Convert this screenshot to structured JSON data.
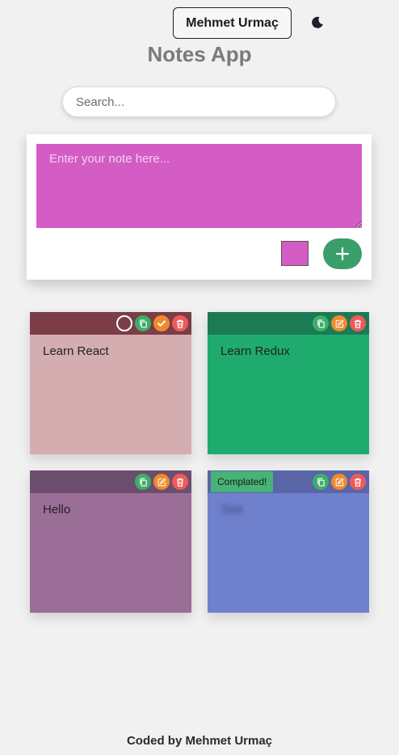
{
  "header": {
    "author_button": "Mehmet Urmaç",
    "theme_icon": "moon-icon",
    "title": "Notes App"
  },
  "search": {
    "placeholder": "Search..."
  },
  "editor": {
    "placeholder": "Enter your note here...",
    "selected_color": "#d35cc5",
    "add_button_color": "#3a9f6a"
  },
  "notes": [
    {
      "text": "Learn React",
      "bar_color": "#7b3d47",
      "body_color": "#d3adb0",
      "completed": false,
      "actions": [
        "check-empty-icon",
        "copy-icon",
        "check-icon",
        "trash-icon"
      ]
    },
    {
      "text": "Learn Redux",
      "bar_color": "#1c7a55",
      "body_color": "#1fab6e",
      "completed": false,
      "actions": [
        "copy-icon",
        "edit-icon",
        "trash-icon"
      ]
    },
    {
      "text": "Hello",
      "bar_color": "#6b4e6e",
      "body_color": "#9a6e97",
      "completed": false,
      "actions": [
        "copy-icon",
        "edit-icon",
        "trash-icon"
      ]
    },
    {
      "text": "Test",
      "bar_color": "#5a65a8",
      "body_color": "#6f80cc",
      "completed": true,
      "badge": "Complated!",
      "badge_color": "#47b377",
      "actions": [
        "copy-icon",
        "edit-icon",
        "trash-icon"
      ]
    }
  ],
  "icon_colors": {
    "copy": "#3dae6b",
    "edit": "#f08a2c",
    "check": "#f08a2c",
    "trash": "#ee5a5a"
  },
  "footer": {
    "text": "Coded by Mehmet Urmaç"
  }
}
